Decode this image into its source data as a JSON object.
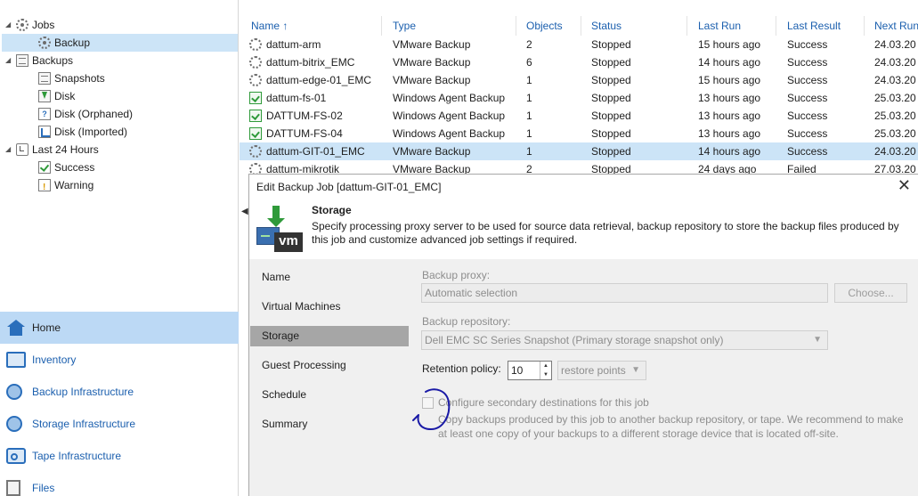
{
  "tree": {
    "items": [
      {
        "label": "Jobs",
        "icon": "jobs-icon",
        "level": 0,
        "expand": "◢"
      },
      {
        "label": "Backup",
        "icon": "backup-job-icon",
        "level": 1,
        "selected": true
      },
      {
        "label": "Backups",
        "icon": "backups-icon",
        "level": 0,
        "expand": "◢"
      },
      {
        "label": "Snapshots",
        "icon": "snapshots-icon",
        "level": 1
      },
      {
        "label": "Disk",
        "icon": "disk-icon",
        "level": 1
      },
      {
        "label": "Disk (Orphaned)",
        "icon": "disk-orphaned-icon",
        "level": 1
      },
      {
        "label": "Disk (Imported)",
        "icon": "disk-imported-icon",
        "level": 1
      },
      {
        "label": "Last 24 Hours",
        "icon": "last-24-hours-icon",
        "level": 0,
        "expand": "◢"
      },
      {
        "label": "Success",
        "icon": "success-icon",
        "level": 1
      },
      {
        "label": "Warning",
        "icon": "warning-icon",
        "level": 1
      }
    ]
  },
  "nav": {
    "items": [
      {
        "label": "Home",
        "icon": "home-icon",
        "active": true
      },
      {
        "label": "Inventory",
        "icon": "inventory-icon"
      },
      {
        "label": "Backup Infrastructure",
        "icon": "backup-infrastructure-icon"
      },
      {
        "label": "Storage Infrastructure",
        "icon": "storage-infrastructure-icon"
      },
      {
        "label": "Tape Infrastructure",
        "icon": "tape-infrastructure-icon"
      },
      {
        "label": "Files",
        "icon": "files-icon"
      }
    ]
  },
  "jobs_table": {
    "sort_arrow": "↑",
    "columns": [
      "Name",
      "Type",
      "Objects",
      "Status",
      "Last Run",
      "Last Result",
      "Next Run"
    ],
    "rows": [
      {
        "name": "dattum-arm",
        "type": "VMware Backup",
        "objects": "2",
        "status": "Stopped",
        "last_run": "15 hours ago",
        "last_result": "Success",
        "next_run": "24.03.20",
        "icon": "vmware-job-icon"
      },
      {
        "name": "dattum-bitrix_EMC",
        "type": "VMware Backup",
        "objects": "6",
        "status": "Stopped",
        "last_run": "14 hours ago",
        "last_result": "Success",
        "next_run": "24.03.20",
        "icon": "vmware-job-icon"
      },
      {
        "name": "dattum-edge-01_EMC",
        "type": "VMware Backup",
        "objects": "1",
        "status": "Stopped",
        "last_run": "15 hours ago",
        "last_result": "Success",
        "next_run": "24.03.20",
        "icon": "vmware-job-icon"
      },
      {
        "name": "dattum-fs-01",
        "type": "Windows Agent Backup",
        "objects": "1",
        "status": "Stopped",
        "last_run": "13 hours ago",
        "last_result": "Success",
        "next_run": "25.03.20",
        "icon": "agent-job-icon"
      },
      {
        "name": "DATTUM-FS-02",
        "type": "Windows Agent Backup",
        "objects": "1",
        "status": "Stopped",
        "last_run": "13 hours ago",
        "last_result": "Success",
        "next_run": "25.03.20",
        "icon": "agent-job-icon"
      },
      {
        "name": "DATTUM-FS-04",
        "type": "Windows Agent Backup",
        "objects": "1",
        "status": "Stopped",
        "last_run": "13 hours ago",
        "last_result": "Success",
        "next_run": "25.03.20",
        "icon": "agent-job-icon"
      },
      {
        "name": "dattum-GIT-01_EMC",
        "type": "VMware Backup",
        "objects": "1",
        "status": "Stopped",
        "last_run": "14 hours ago",
        "last_result": "Success",
        "next_run": "24.03.20",
        "icon": "vmware-job-icon",
        "selected": true
      },
      {
        "name": "dattum-mikrotik",
        "type": "VMware Backup",
        "objects": "2",
        "status": "Stopped",
        "last_run": "24 days ago",
        "last_result": "Failed",
        "next_run": "27.03.20",
        "icon": "vmware-job-icon"
      }
    ]
  },
  "collapse_arrow": "◀",
  "dialog": {
    "title": "Edit Backup Job [dattum-GIT-01_EMC]",
    "close": "✕",
    "wizard_icon_text": "vm",
    "step_title": "Storage",
    "step_description": "Specify processing proxy server to be used for source data retrieval, backup repository to store the backup files produced by this job and customize advanced job settings if required.",
    "steps": [
      {
        "label": "Name"
      },
      {
        "label": "Virtual Machines"
      },
      {
        "label": "Storage",
        "current": true
      },
      {
        "label": "Guest Processing"
      },
      {
        "label": "Schedule"
      },
      {
        "label": "Summary"
      }
    ],
    "backup_proxy_label": "Backup proxy:",
    "backup_proxy_value": "Automatic selection",
    "choose_button": "Choose...",
    "backup_repository_label": "Backup repository:",
    "backup_repository_value": "Dell EMC SC Series Snapshot (Primary storage snapshot only)",
    "retention_label": "Retention policy:",
    "retention_value": "10",
    "retention_unit": "restore points",
    "secondary_checkbox_label": "Configure secondary destinations for this job",
    "secondary_checked": false,
    "secondary_description": "Copy backups produced by this job to another backup repository, or tape. We recommend to make at least one copy of your backups to a different storage device that is located off-site."
  },
  "colors": {
    "accent_blue": "#1b5fae",
    "selection": "#cce4f7",
    "nav_active": "#bcd9f5",
    "annotation_ink": "#1a1aa6"
  }
}
